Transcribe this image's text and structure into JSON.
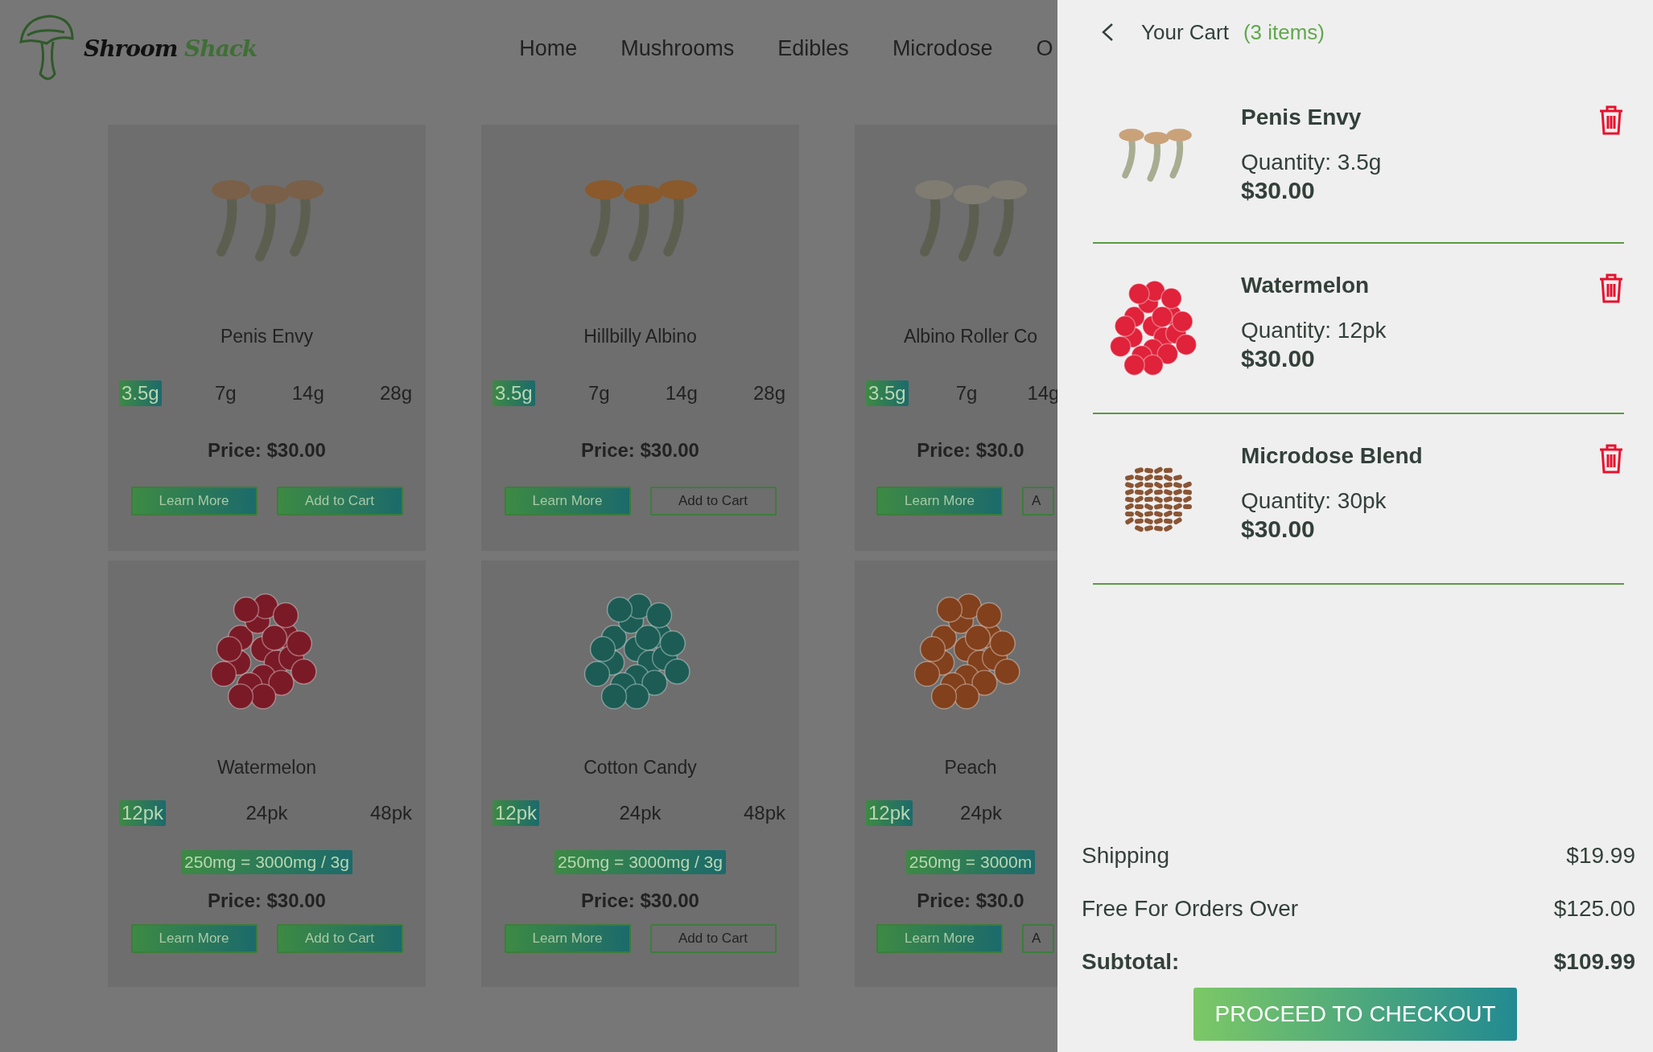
{
  "logo": {
    "first": "Shroom",
    "second": "Shack"
  },
  "nav": [
    {
      "label": "Home"
    },
    {
      "label": "Mushrooms"
    },
    {
      "label": "Edibles"
    },
    {
      "label": "Microdose"
    },
    {
      "label": "O"
    }
  ],
  "product_rows": [
    {
      "cards": [
        {
          "kind": "mushroom",
          "name": "Penis Envy",
          "color": "#7a6048",
          "cut_off": false,
          "sizes": [
            {
              "label": "3.5g",
              "selected": true
            },
            {
              "label": "7g",
              "selected": false
            },
            {
              "label": "14g",
              "selected": false
            },
            {
              "label": "28g",
              "selected": false
            }
          ],
          "price": "Price: $30.00",
          "buttons": [
            {
              "label": "Learn More",
              "filled": true
            },
            {
              "label": "Add to Cart",
              "filled": true
            }
          ]
        },
        {
          "kind": "mushroom",
          "name": "Hillbilly Albino",
          "color": "#8a5a2c",
          "cut_off": false,
          "sizes": [
            {
              "label": "3.5g",
              "selected": true
            },
            {
              "label": "7g",
              "selected": false
            },
            {
              "label": "14g",
              "selected": false
            },
            {
              "label": "28g",
              "selected": false
            }
          ],
          "price": "Price: $30.00",
          "buttons": [
            {
              "label": "Learn More",
              "filled": true
            },
            {
              "label": "Add to Cart",
              "filled": false
            }
          ]
        },
        {
          "kind": "mushroom",
          "name": "Albino Roller Co",
          "color": "#807c72",
          "cut_off": true,
          "sizes": [
            {
              "label": "3.5g",
              "selected": true
            },
            {
              "label": "7g",
              "selected": false
            },
            {
              "label": "14g",
              "selected": false
            }
          ],
          "price": "Price: $30.0",
          "buttons": [
            {
              "label": "Learn More",
              "filled": true
            },
            {
              "label": "A",
              "filled": false
            }
          ]
        }
      ]
    },
    {
      "cards": [
        {
          "kind": "gummy",
          "name": "Watermelon",
          "color": "#7a1a26",
          "cut_off": false,
          "sizes": [
            {
              "label": "12pk",
              "selected": true
            },
            {
              "label": "24pk",
              "selected": false
            },
            {
              "label": "48pk",
              "selected": false
            }
          ],
          "dosage": "250mg = 3000mg / 3g",
          "price": "Price: $30.00",
          "buttons": [
            {
              "label": "Learn More",
              "filled": true
            },
            {
              "label": "Add to Cart",
              "filled": true
            }
          ]
        },
        {
          "kind": "gummy",
          "name": "Cotton Candy",
          "color": "#1c5c54",
          "cut_off": false,
          "sizes": [
            {
              "label": "12pk",
              "selected": true
            },
            {
              "label": "24pk",
              "selected": false
            },
            {
              "label": "48pk",
              "selected": false
            }
          ],
          "dosage": "250mg = 3000mg / 3g",
          "price": "Price: $30.00",
          "buttons": [
            {
              "label": "Learn More",
              "filled": true
            },
            {
              "label": "Add to Cart",
              "filled": false
            }
          ]
        },
        {
          "kind": "gummy",
          "name": "Peach",
          "color": "#82401c",
          "cut_off": true,
          "sizes": [
            {
              "label": "12pk",
              "selected": true
            },
            {
              "label": "24pk",
              "selected": false
            }
          ],
          "dosage": "250mg = 3000m",
          "price": "Price: $30.0",
          "buttons": [
            {
              "label": "Learn More",
              "filled": true
            },
            {
              "label": "A",
              "filled": false
            }
          ]
        }
      ]
    }
  ],
  "cart": {
    "title": "Your Cart",
    "count": "(3 items)",
    "items": [
      {
        "kind": "mushroom",
        "color": "#c9a27a",
        "name": "Penis Envy",
        "quantity": "Quantity: 3.5g",
        "price": "$30.00"
      },
      {
        "kind": "gummy",
        "color": "#e0223a",
        "name": "Watermelon",
        "quantity": "Quantity: 12pk",
        "price": "$30.00"
      },
      {
        "kind": "capsules",
        "color": "#8a5535",
        "name": "Microdose Blend",
        "quantity": "Quantity: 30pk",
        "price": "$30.00"
      }
    ],
    "summary": [
      {
        "label": "Shipping",
        "value": "$19.99",
        "bold": false
      },
      {
        "label": "Free For Orders Over",
        "value": "$125.00",
        "bold": false
      },
      {
        "label": "Subtotal:",
        "value": "$109.99",
        "bold": true
      }
    ],
    "checkout": "PROCEED TO CHECKOUT"
  }
}
